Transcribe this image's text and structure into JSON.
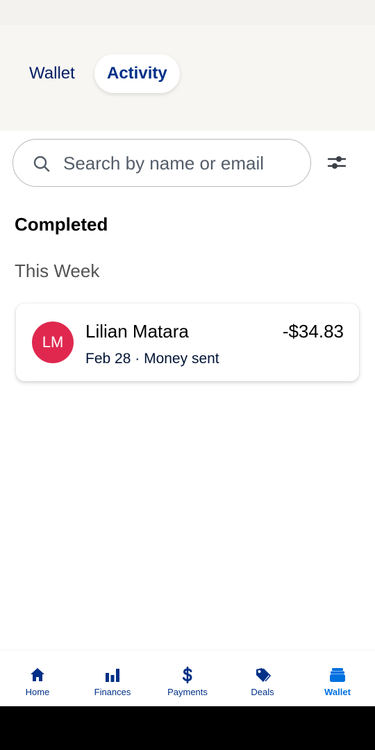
{
  "tabs": [
    {
      "label": "Wallet",
      "active": false
    },
    {
      "label": "Activity",
      "active": true
    }
  ],
  "search": {
    "placeholder": "Search by name or email",
    "value": ""
  },
  "section_title": "Completed",
  "group_title": "This Week",
  "transactions": [
    {
      "initials": "LM",
      "name": "Lilian Matara",
      "amount": "-$34.83",
      "date": "Feb 28",
      "separator": "·",
      "type": "Money sent",
      "avatar_color": "#e0284f"
    }
  ],
  "nav": [
    {
      "label": "Home",
      "icon": "home-icon",
      "active": false
    },
    {
      "label": "Finances",
      "icon": "bar-chart-icon",
      "active": false
    },
    {
      "label": "Payments",
      "icon": "dollar-icon",
      "active": false
    },
    {
      "label": "Deals",
      "icon": "tag-icon",
      "active": false
    },
    {
      "label": "Wallet",
      "icon": "wallet-icon",
      "active": true
    }
  ],
  "colors": {
    "primary": "#003087",
    "active": "#0070e0",
    "avatar": "#e0284f"
  }
}
